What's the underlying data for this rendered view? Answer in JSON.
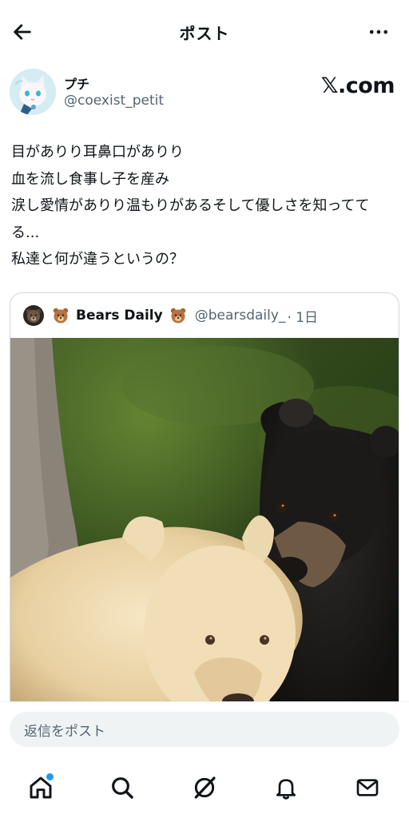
{
  "header": {
    "title": "ポスト"
  },
  "author": {
    "name": "プチ",
    "handle": "@coexist_petit",
    "watermark": "𝕏.com"
  },
  "post": {
    "lines": [
      "目がありり耳鼻口がありり",
      "血を流し食事し子を産み",
      "涙し愛情がありり温もりがあるそして優しさを知ってて",
      "る...",
      "私達と何が違うというの？"
    ]
  },
  "quote": {
    "name": "Bears Daily",
    "handle": "@bearsdaily_",
    "time": "· 1日"
  },
  "reply": {
    "placeholder": "返信をポスト"
  },
  "nav": {
    "items": [
      "home-icon",
      "search-icon",
      "grok-icon",
      "notifications-icon",
      "messages-icon"
    ],
    "active": "home-icon",
    "dot_color": "#1d9bf0"
  },
  "colors": {
    "text": "#0f1419",
    "secondary": "#536471",
    "border": "#cfd9de",
    "input_bg": "#eff3f4"
  }
}
